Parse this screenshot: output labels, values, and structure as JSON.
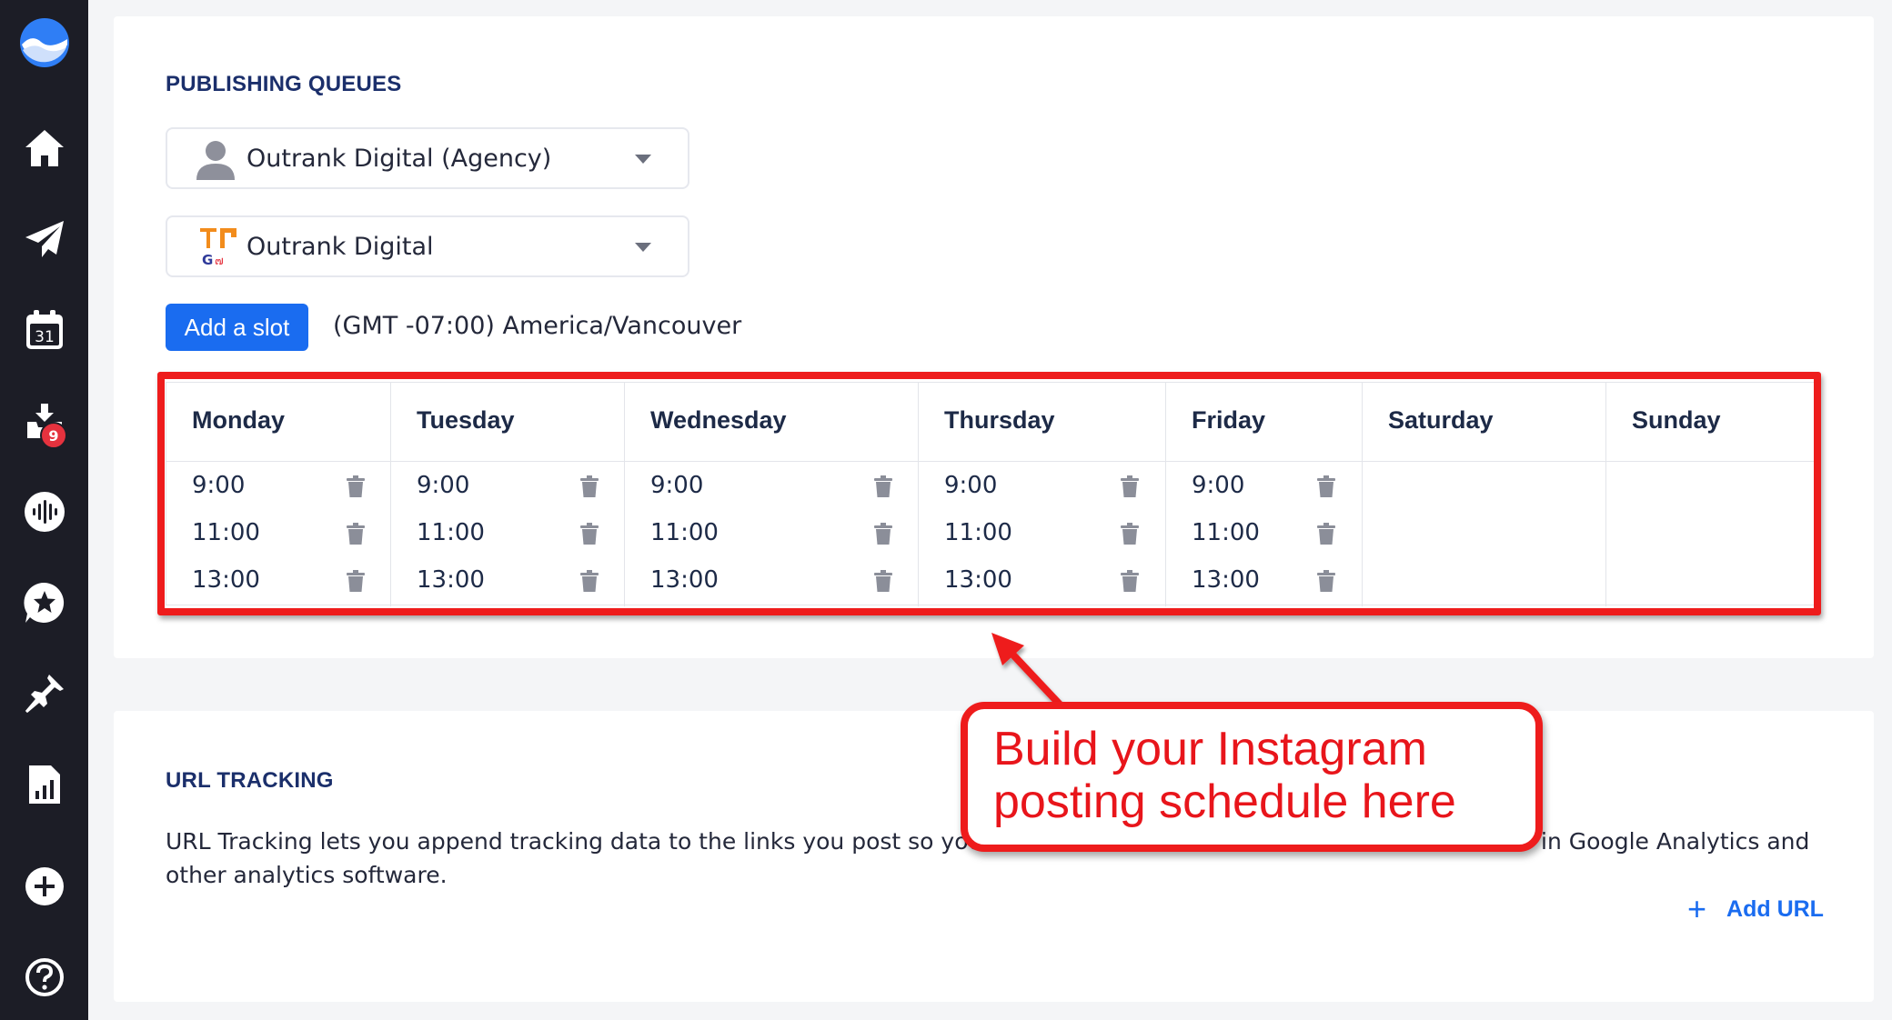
{
  "sidebar": {
    "items": [
      {
        "icon": "logo-icon"
      },
      {
        "icon": "home-icon"
      },
      {
        "icon": "paper-plane-icon"
      },
      {
        "icon": "calendar-icon",
        "label": "31"
      },
      {
        "icon": "inbox-icon",
        "badge": "9"
      },
      {
        "icon": "audio-wave-icon"
      },
      {
        "icon": "star-chat-icon"
      },
      {
        "icon": "pin-icon"
      },
      {
        "icon": "report-icon"
      },
      {
        "icon": "add-circle-icon"
      },
      {
        "icon": "help-icon"
      }
    ]
  },
  "publishing": {
    "title": "PUBLISHING QUEUES",
    "account_dropdown": "Outrank Digital (Agency)",
    "profile_dropdown": "Outrank Digital",
    "add_slot_label": "Add a slot",
    "timezone": "(GMT -07:00) America/Vancouver"
  },
  "schedule": {
    "days": [
      {
        "name": "Monday",
        "slots": [
          "9:00",
          "11:00",
          "13:00"
        ]
      },
      {
        "name": "Tuesday",
        "slots": [
          "9:00",
          "11:00",
          "13:00"
        ]
      },
      {
        "name": "Wednesday",
        "slots": [
          "9:00",
          "11:00",
          "13:00"
        ]
      },
      {
        "name": "Thursday",
        "slots": [
          "9:00",
          "11:00",
          "13:00"
        ]
      },
      {
        "name": "Friday",
        "slots": [
          "9:00",
          "11:00",
          "13:00"
        ]
      },
      {
        "name": "Saturday",
        "slots": []
      },
      {
        "name": "Sunday",
        "slots": []
      }
    ]
  },
  "callout": {
    "line1": "Build your Instagram",
    "line2": "posting schedule here"
  },
  "url_tracking": {
    "title": "URL TRACKING",
    "description_visible_left": "URL Tracking lets you append tracking data to the links you post so you",
    "description_visible_right": "in Google Analytics and",
    "description_line2": "other analytics software.",
    "add_url_label": "Add URL"
  },
  "colors": {
    "sidebar_bg": "#1c1d26",
    "accent_blue": "#1a6cf0",
    "highlight_red": "#ee1c1c",
    "title_navy": "#1b2f6b"
  }
}
